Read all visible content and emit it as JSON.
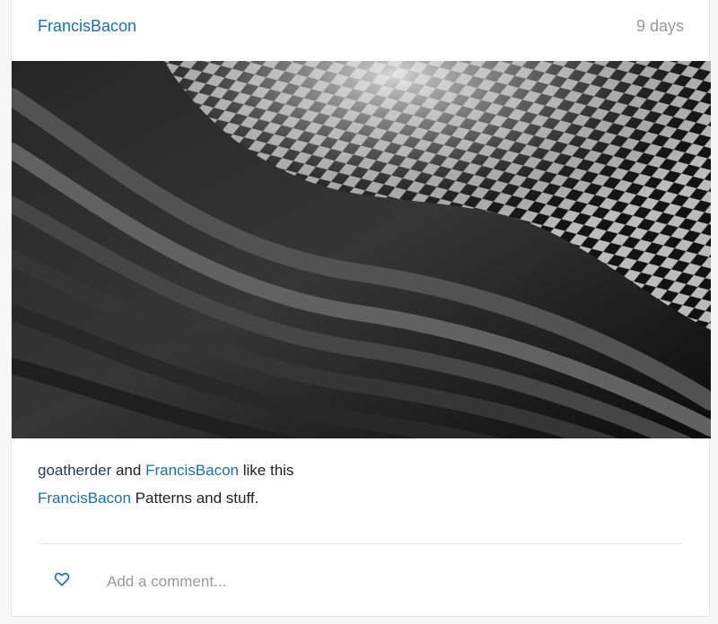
{
  "post": {
    "author": "FrancisBacon",
    "time_ago": "9 days",
    "likes": {
      "user1": "goatherder",
      "conjunction": "and",
      "user2": "FrancisBacon",
      "suffix": "like this"
    },
    "caption": {
      "author": "FrancisBacon",
      "text": "Patterns and stuff."
    },
    "comment_placeholder": "Add a comment...",
    "like_icon": "heart-outline-icon",
    "accent_color": "#1a6fb5"
  }
}
